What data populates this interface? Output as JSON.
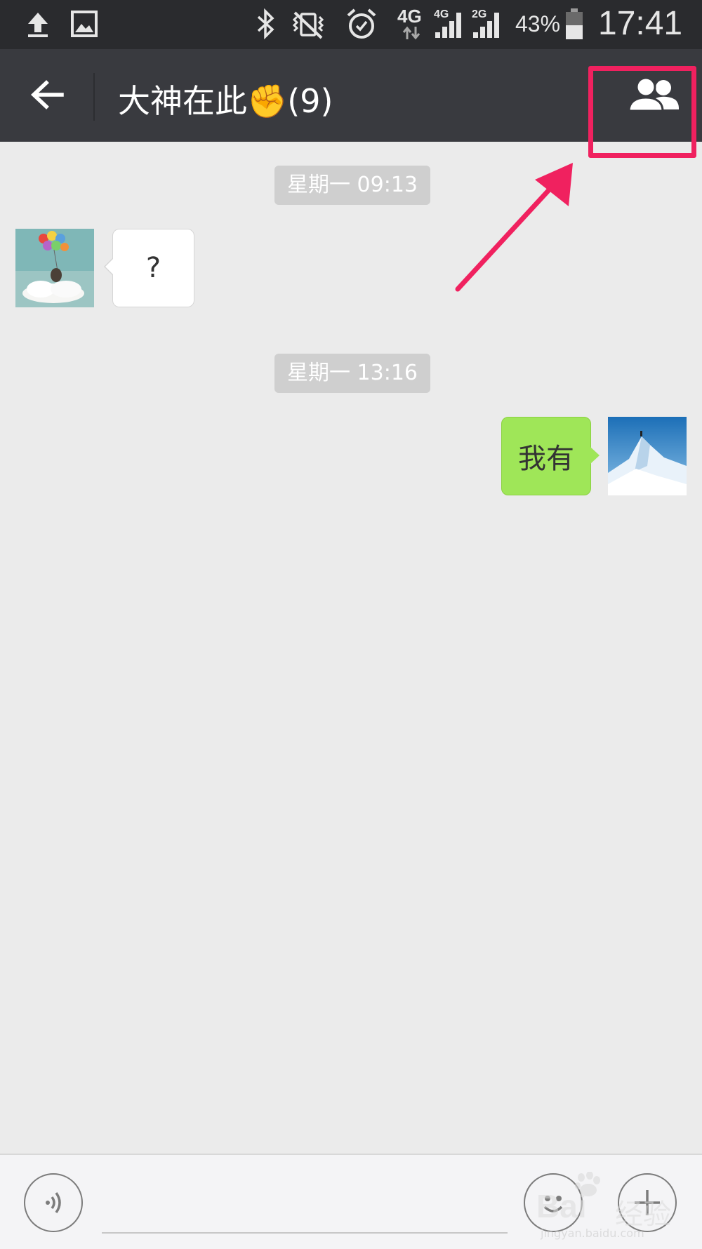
{
  "status_bar": {
    "battery": "43%",
    "time": "17:41",
    "network_4g_main": "4G",
    "network_4g_small": "4G",
    "network_2g": "2G",
    "icons": [
      "upload-icon",
      "gallery-icon",
      "bluetooth-icon",
      "vibrate-mute-icon",
      "alarm-icon",
      "data-transfer-icon",
      "signal-icon",
      "battery-icon"
    ]
  },
  "header": {
    "title": "大神在此✊(9)",
    "back_icon": "back-arrow-icon",
    "group_members_icon": "group-members-icon"
  },
  "messages": [
    {
      "type": "timestamp",
      "text": "星期一 09:13"
    },
    {
      "type": "incoming",
      "text": "?",
      "avatar": "balloon-avatar"
    },
    {
      "type": "timestamp",
      "text": "星期一 13:16"
    },
    {
      "type": "outgoing",
      "text": "我有",
      "avatar": "mountain-avatar"
    }
  ],
  "input_bar": {
    "voice_icon": "voice-icon",
    "emoji_icon": "emoji-icon",
    "plus_icon": "plus-icon"
  },
  "watermark": {
    "brand": "Bai",
    "brand_cn": "经验",
    "url": "jingyan.baidu.com"
  },
  "annotation": {
    "highlight_color": "#f0215f"
  }
}
